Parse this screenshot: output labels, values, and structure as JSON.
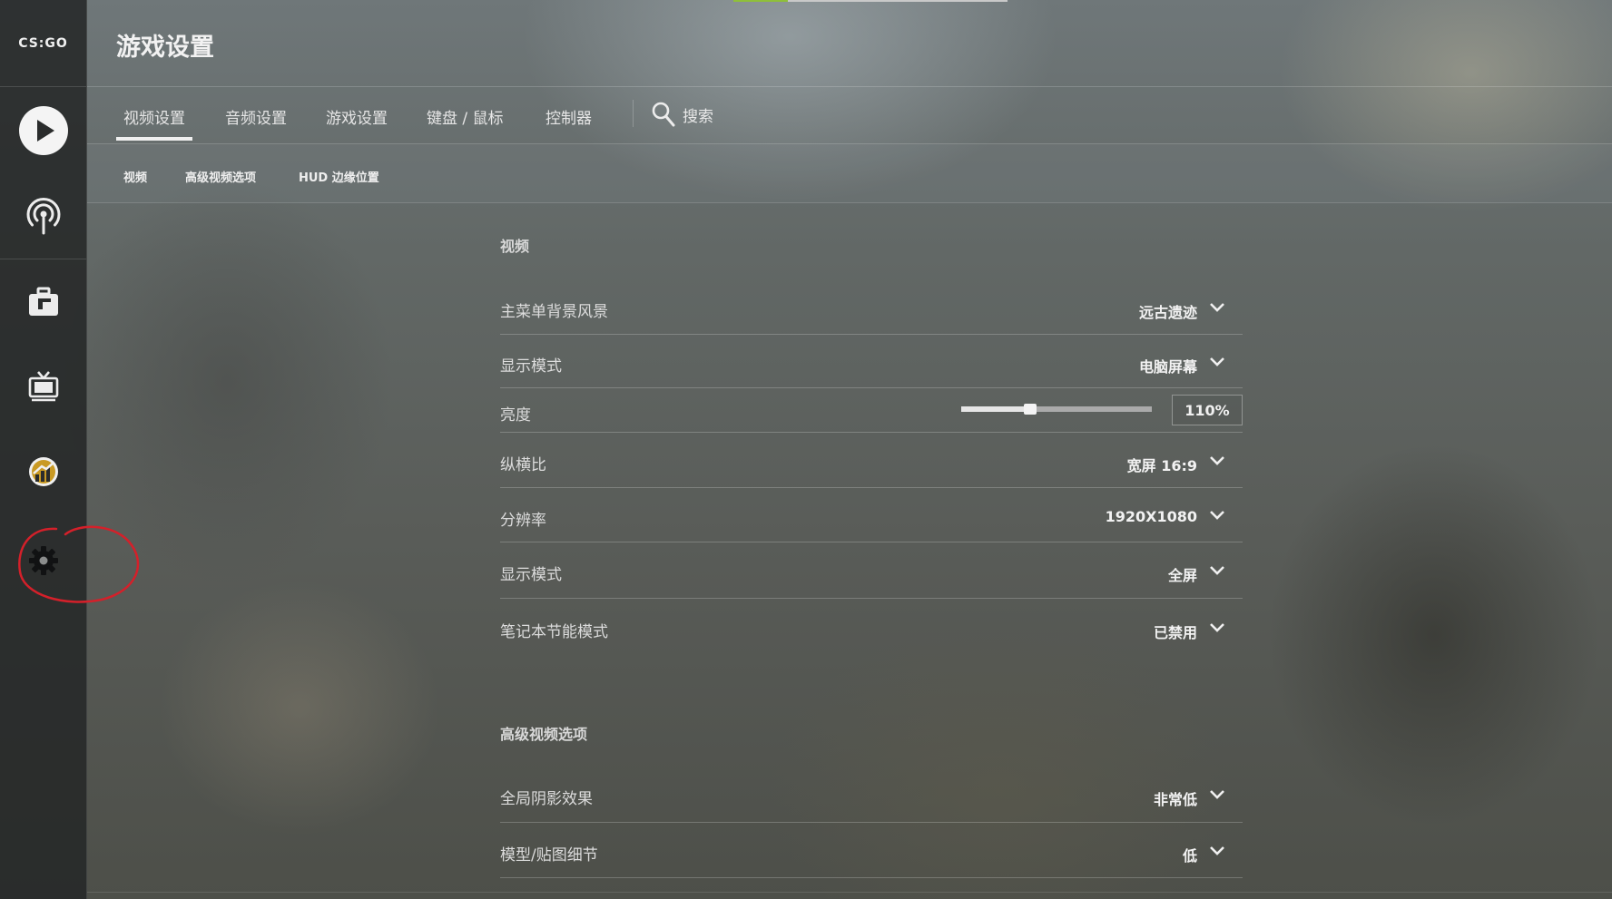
{
  "app": {
    "logo_text": "CS:GO",
    "page_title": "游戏设置"
  },
  "sidebar": {
    "items": [
      {
        "name": "play",
        "icon": "play-icon"
      },
      {
        "name": "watch",
        "icon": "broadcast-icon"
      },
      {
        "name": "inventory",
        "icon": "briefcase-icon"
      },
      {
        "name": "tv",
        "icon": "tv-icon"
      },
      {
        "name": "stats",
        "icon": "stats-icon"
      },
      {
        "name": "settings",
        "icon": "gear-icon",
        "highlighted": true
      }
    ],
    "annotation_color": "#d4202a"
  },
  "tabs": [
    {
      "label": "视频设置",
      "active": true
    },
    {
      "label": "音频设置"
    },
    {
      "label": "游戏设置"
    },
    {
      "label": "键盘 / 鼠标"
    },
    {
      "label": "控制器"
    }
  ],
  "search": {
    "label": "搜索"
  },
  "subtabs": [
    {
      "label": "视频"
    },
    {
      "label": "高级视频选项"
    },
    {
      "label": "HUD 边缘位置"
    }
  ],
  "sections": {
    "video": {
      "title": "视频",
      "rows": [
        {
          "label": "主菜单背景风景",
          "value": "远古遗迹"
        },
        {
          "label": "显示模式",
          "value": "电脑屏幕"
        },
        {
          "label": "亮度",
          "value": "110%",
          "slider_fraction": 0.36
        },
        {
          "label": "纵横比",
          "value": "宽屏 16:9"
        },
        {
          "label": "分辨率",
          "value": "1920X1080"
        },
        {
          "label": "显示模式",
          "value": "全屏"
        },
        {
          "label": "笔记本节能模式",
          "value": "已禁用"
        }
      ]
    },
    "advanced": {
      "title": "高级视频选项",
      "rows": [
        {
          "label": "全局阴影效果",
          "value": "非常低"
        },
        {
          "label": "模型/贴图细节",
          "value": "低"
        }
      ]
    }
  }
}
